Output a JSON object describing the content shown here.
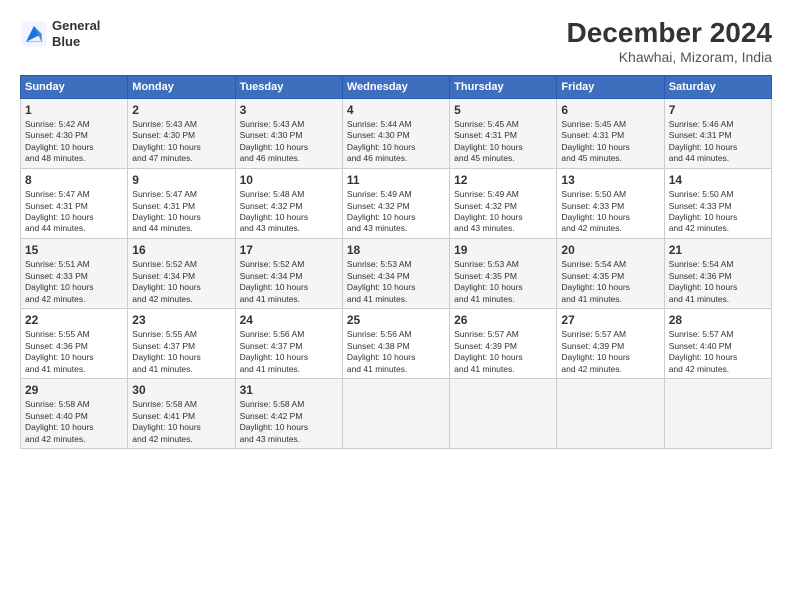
{
  "logo": {
    "line1": "General",
    "line2": "Blue"
  },
  "title": "December 2024",
  "subtitle": "Khawhai, Mizoram, India",
  "days_header": [
    "Sunday",
    "Monday",
    "Tuesday",
    "Wednesday",
    "Thursday",
    "Friday",
    "Saturday"
  ],
  "weeks": [
    [
      {
        "day": "1",
        "lines": [
          "Sunrise: 5:42 AM",
          "Sunset: 4:30 PM",
          "Daylight: 10 hours",
          "and 48 minutes."
        ]
      },
      {
        "day": "2",
        "lines": [
          "Sunrise: 5:43 AM",
          "Sunset: 4:30 PM",
          "Daylight: 10 hours",
          "and 47 minutes."
        ]
      },
      {
        "day": "3",
        "lines": [
          "Sunrise: 5:43 AM",
          "Sunset: 4:30 PM",
          "Daylight: 10 hours",
          "and 46 minutes."
        ]
      },
      {
        "day": "4",
        "lines": [
          "Sunrise: 5:44 AM",
          "Sunset: 4:30 PM",
          "Daylight: 10 hours",
          "and 46 minutes."
        ]
      },
      {
        "day": "5",
        "lines": [
          "Sunrise: 5:45 AM",
          "Sunset: 4:31 PM",
          "Daylight: 10 hours",
          "and 45 minutes."
        ]
      },
      {
        "day": "6",
        "lines": [
          "Sunrise: 5:45 AM",
          "Sunset: 4:31 PM",
          "Daylight: 10 hours",
          "and 45 minutes."
        ]
      },
      {
        "day": "7",
        "lines": [
          "Sunrise: 5:46 AM",
          "Sunset: 4:31 PM",
          "Daylight: 10 hours",
          "and 44 minutes."
        ]
      }
    ],
    [
      {
        "day": "8",
        "lines": [
          "Sunrise: 5:47 AM",
          "Sunset: 4:31 PM",
          "Daylight: 10 hours",
          "and 44 minutes."
        ]
      },
      {
        "day": "9",
        "lines": [
          "Sunrise: 5:47 AM",
          "Sunset: 4:31 PM",
          "Daylight: 10 hours",
          "and 44 minutes."
        ]
      },
      {
        "day": "10",
        "lines": [
          "Sunrise: 5:48 AM",
          "Sunset: 4:32 PM",
          "Daylight: 10 hours",
          "and 43 minutes."
        ]
      },
      {
        "day": "11",
        "lines": [
          "Sunrise: 5:49 AM",
          "Sunset: 4:32 PM",
          "Daylight: 10 hours",
          "and 43 minutes."
        ]
      },
      {
        "day": "12",
        "lines": [
          "Sunrise: 5:49 AM",
          "Sunset: 4:32 PM",
          "Daylight: 10 hours",
          "and 43 minutes."
        ]
      },
      {
        "day": "13",
        "lines": [
          "Sunrise: 5:50 AM",
          "Sunset: 4:33 PM",
          "Daylight: 10 hours",
          "and 42 minutes."
        ]
      },
      {
        "day": "14",
        "lines": [
          "Sunrise: 5:50 AM",
          "Sunset: 4:33 PM",
          "Daylight: 10 hours",
          "and 42 minutes."
        ]
      }
    ],
    [
      {
        "day": "15",
        "lines": [
          "Sunrise: 5:51 AM",
          "Sunset: 4:33 PM",
          "Daylight: 10 hours",
          "and 42 minutes."
        ]
      },
      {
        "day": "16",
        "lines": [
          "Sunrise: 5:52 AM",
          "Sunset: 4:34 PM",
          "Daylight: 10 hours",
          "and 42 minutes."
        ]
      },
      {
        "day": "17",
        "lines": [
          "Sunrise: 5:52 AM",
          "Sunset: 4:34 PM",
          "Daylight: 10 hours",
          "and 41 minutes."
        ]
      },
      {
        "day": "18",
        "lines": [
          "Sunrise: 5:53 AM",
          "Sunset: 4:34 PM",
          "Daylight: 10 hours",
          "and 41 minutes."
        ]
      },
      {
        "day": "19",
        "lines": [
          "Sunrise: 5:53 AM",
          "Sunset: 4:35 PM",
          "Daylight: 10 hours",
          "and 41 minutes."
        ]
      },
      {
        "day": "20",
        "lines": [
          "Sunrise: 5:54 AM",
          "Sunset: 4:35 PM",
          "Daylight: 10 hours",
          "and 41 minutes."
        ]
      },
      {
        "day": "21",
        "lines": [
          "Sunrise: 5:54 AM",
          "Sunset: 4:36 PM",
          "Daylight: 10 hours",
          "and 41 minutes."
        ]
      }
    ],
    [
      {
        "day": "22",
        "lines": [
          "Sunrise: 5:55 AM",
          "Sunset: 4:36 PM",
          "Daylight: 10 hours",
          "and 41 minutes."
        ]
      },
      {
        "day": "23",
        "lines": [
          "Sunrise: 5:55 AM",
          "Sunset: 4:37 PM",
          "Daylight: 10 hours",
          "and 41 minutes."
        ]
      },
      {
        "day": "24",
        "lines": [
          "Sunrise: 5:56 AM",
          "Sunset: 4:37 PM",
          "Daylight: 10 hours",
          "and 41 minutes."
        ]
      },
      {
        "day": "25",
        "lines": [
          "Sunrise: 5:56 AM",
          "Sunset: 4:38 PM",
          "Daylight: 10 hours",
          "and 41 minutes."
        ]
      },
      {
        "day": "26",
        "lines": [
          "Sunrise: 5:57 AM",
          "Sunset: 4:39 PM",
          "Daylight: 10 hours",
          "and 41 minutes."
        ]
      },
      {
        "day": "27",
        "lines": [
          "Sunrise: 5:57 AM",
          "Sunset: 4:39 PM",
          "Daylight: 10 hours",
          "and 42 minutes."
        ]
      },
      {
        "day": "28",
        "lines": [
          "Sunrise: 5:57 AM",
          "Sunset: 4:40 PM",
          "Daylight: 10 hours",
          "and 42 minutes."
        ]
      }
    ],
    [
      {
        "day": "29",
        "lines": [
          "Sunrise: 5:58 AM",
          "Sunset: 4:40 PM",
          "Daylight: 10 hours",
          "and 42 minutes."
        ]
      },
      {
        "day": "30",
        "lines": [
          "Sunrise: 5:58 AM",
          "Sunset: 4:41 PM",
          "Daylight: 10 hours",
          "and 42 minutes."
        ]
      },
      {
        "day": "31",
        "lines": [
          "Sunrise: 5:58 AM",
          "Sunset: 4:42 PM",
          "Daylight: 10 hours",
          "and 43 minutes."
        ]
      },
      null,
      null,
      null,
      null
    ]
  ]
}
